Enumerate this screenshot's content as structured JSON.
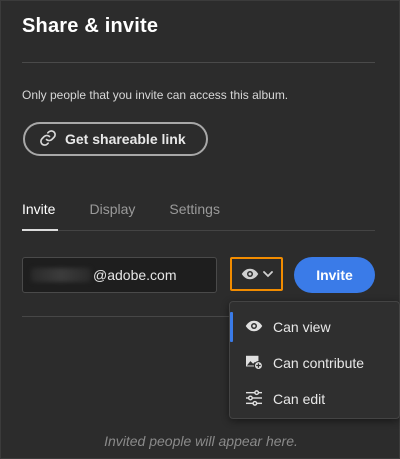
{
  "dialog": {
    "title": "Share & invite",
    "description": "Only people that you invite can access this album.",
    "shareable_link_label": "Get shareable link"
  },
  "tabs": [
    {
      "label": "Invite",
      "active": true
    },
    {
      "label": "Display",
      "active": false
    },
    {
      "label": "Settings",
      "active": false
    }
  ],
  "invite": {
    "email_value_visible": "@adobe.com",
    "permission_icon": "eye-icon",
    "invite_button_label": "Invite"
  },
  "permission_menu": {
    "items": [
      {
        "label": "Can view",
        "icon": "eye-icon",
        "selected": true
      },
      {
        "label": "Can contribute",
        "icon": "add-photo-icon",
        "selected": false
      },
      {
        "label": "Can edit",
        "icon": "sliders-icon",
        "selected": false
      }
    ]
  },
  "empty_state": {
    "text": "Invited people will appear here."
  },
  "colors": {
    "background": "#2c2c2c",
    "accent_blue": "#3a7be8",
    "focus_orange": "#f28c00"
  }
}
